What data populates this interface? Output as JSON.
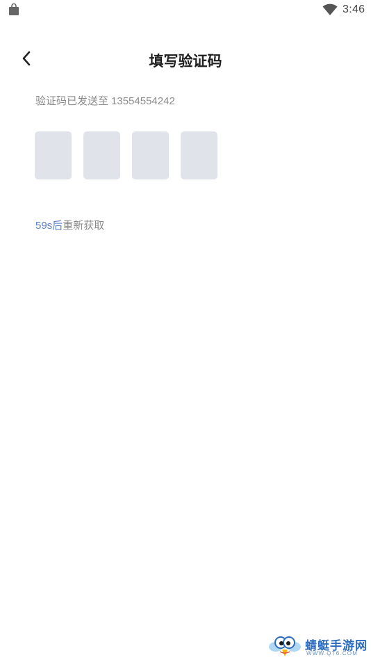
{
  "status_bar": {
    "time": "3:46",
    "left_icon": "shopping-bag-icon",
    "right_icon": "wifi-icon"
  },
  "header": {
    "back_icon": "chevron-left-icon",
    "title": "填写验证码"
  },
  "hint": {
    "text": "验证码已发送至",
    "phone": "13554554242"
  },
  "code_boxes": [
    "",
    "",
    "",
    ""
  ],
  "resend": {
    "countdown": "59s后",
    "label": "重新获取",
    "countdown_color": "#5b7fc6"
  },
  "watermark": {
    "name": "蜻蜓手游网",
    "url": "WWW.QT6.COM"
  },
  "colors": {
    "code_box_bg": "#e1e3ea",
    "hint_text": "#8b8b8b",
    "title_text": "#1f1f1f"
  }
}
